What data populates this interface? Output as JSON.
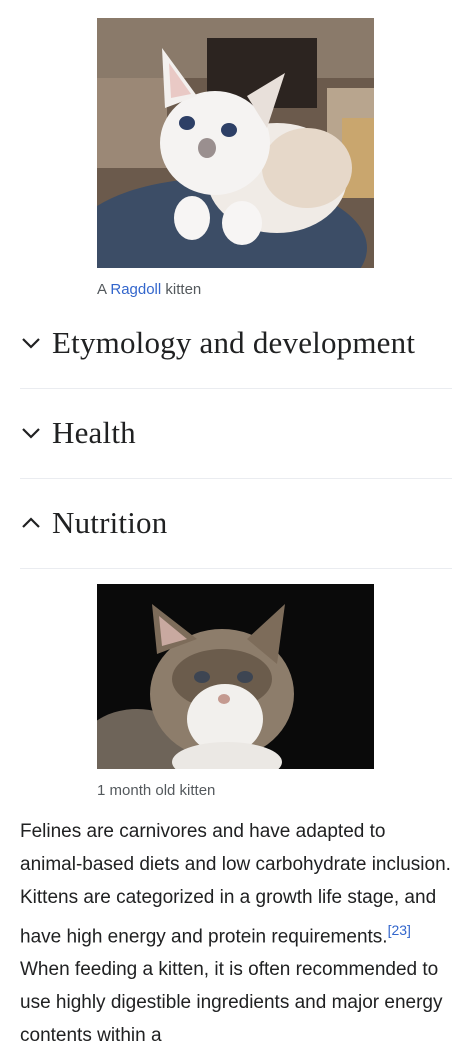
{
  "figure1": {
    "caption_prefix": "A ",
    "caption_link": "Ragdoll",
    "caption_suffix": " kitten",
    "image_alt": "Ragdoll kitten photo"
  },
  "sections": [
    {
      "title": "Etymology and development",
      "expanded": false,
      "icon": "chevron-down-icon"
    },
    {
      "title": "Health",
      "expanded": false,
      "icon": "chevron-down-icon"
    },
    {
      "title": "Nutrition",
      "expanded": true,
      "icon": "chevron-up-icon"
    }
  ],
  "figure2": {
    "caption": "1 month old kitten",
    "image_alt": "Tabby kitten photo on black background"
  },
  "nutrition": {
    "text_part1": "Felines are carnivores and have adapted to animal-based diets and low carbohydrate inclusion. Kittens are categorized in a growth life stage, and have high energy and protein requirements.",
    "citation": "[23]",
    "text_part2": " When feeding a kitten, it is often recommended to use highly digestible ingredients and major energy contents within a"
  },
  "colors": {
    "link": "#3366cc",
    "text": "#202122",
    "caption": "#54595d",
    "divider": "#eaecf0"
  }
}
